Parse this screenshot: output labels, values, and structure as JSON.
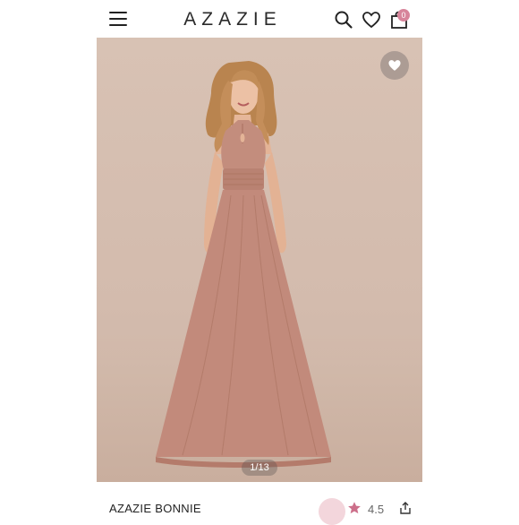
{
  "header": {
    "brand": "AZAZIE",
    "cart_count": "0"
  },
  "gallery": {
    "counter": "1/13"
  },
  "product": {
    "name": "AZAZIE BONNIE",
    "rating": "4.5"
  },
  "colors": {
    "accent": "#d7849a",
    "dress": "#c08a7a",
    "background": "#d8c2b4"
  },
  "icons": [
    "menu-icon",
    "search-icon",
    "heart-icon",
    "bag-icon",
    "star-icon",
    "share-icon"
  ]
}
